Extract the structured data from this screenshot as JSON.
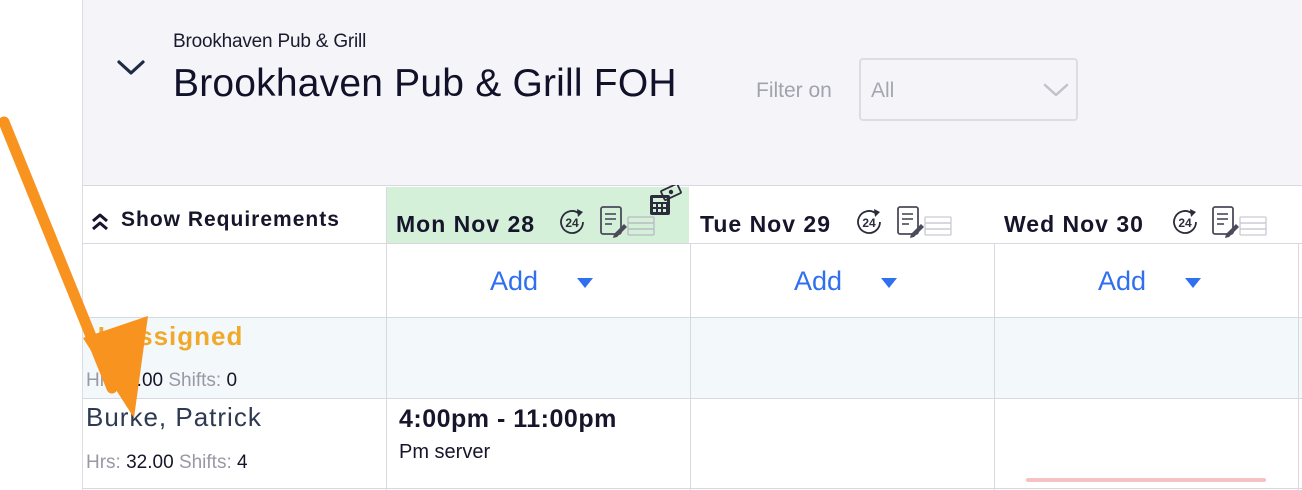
{
  "header": {
    "location": "Brookhaven Pub & Grill",
    "title": "Brookhaven Pub & Grill FOH",
    "filter_label": "Filter on",
    "filter_value": "All"
  },
  "toolbar": {
    "show_requirements": "Show Requirements"
  },
  "days": [
    {
      "label": "Mon Nov 28",
      "badge": "24",
      "today": true
    },
    {
      "label": "Tue Nov 29",
      "badge": "24",
      "today": false
    },
    {
      "label": "Wed Nov 30",
      "badge": "24",
      "today": false
    }
  ],
  "add_label": "Add",
  "unassigned": {
    "name": "Unassigned",
    "hrs_label": "Hrs:",
    "hrs": "0.00",
    "shifts_label": "Shifts:",
    "shifts": "0"
  },
  "employees": [
    {
      "name": "Burke, Patrick",
      "hrs_label": "Hrs:",
      "hrs": "32.00",
      "shifts_label": "Shifts:",
      "shifts": "4",
      "shift": {
        "time": "4:00pm - 11:00pm",
        "role": "Pm server"
      }
    }
  ],
  "colors": {
    "accent": "#2f6ff0",
    "unassigned": "#f0a92a",
    "today": "#d5f0d9",
    "annotation_arrow": "#f7931e"
  },
  "icons": [
    "chevron-down-icon",
    "double-chevron-up-icon",
    "clock-24-icon",
    "notes-icon",
    "calculator-icon",
    "caret-down-icon"
  ]
}
